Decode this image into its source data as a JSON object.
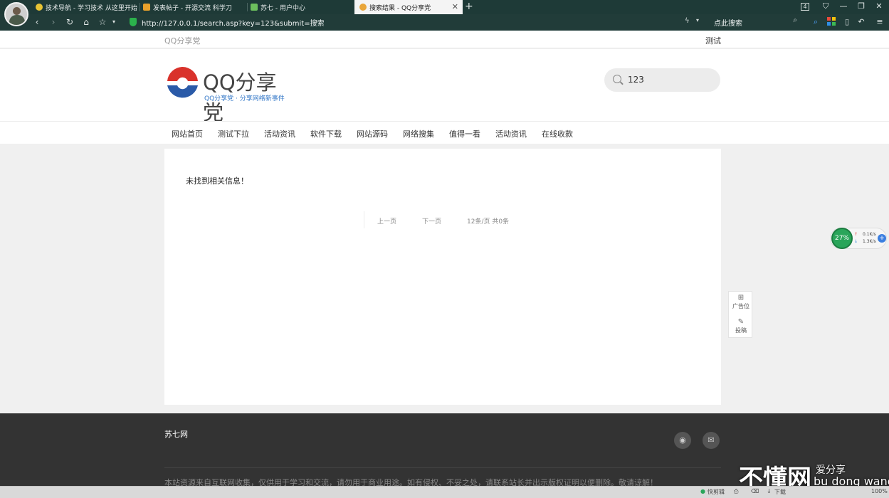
{
  "browser": {
    "tabs": [
      {
        "title": "技术导航 - 学习技术 从这里开始",
        "icon_color": "#e8c435",
        "active": false
      },
      {
        "title": "发表帖子 - 开源交流 科学刀",
        "icon_color": "#e8a12b",
        "active": false
      },
      {
        "title": "苏七 - 用户中心",
        "icon_color": "#6cbf5d",
        "active": false
      },
      {
        "title": "搜索结果 - QQ分享党",
        "icon_color": "#e9a63a",
        "active": true
      }
    ],
    "tab_count": "4",
    "url": "http://127.0.0.1/search.asp?key=123&submit=搜索",
    "search_placeholder": "点此搜索"
  },
  "site": {
    "name": "QQ分享党",
    "topbar_right": "测试",
    "logo_text": "QQ分享党",
    "logo_subtitle": "QQ分享党 · 分享网络新事件",
    "search_value": "123",
    "nav": [
      "网站首页",
      "测试下拉",
      "活动资讯",
      "软件下载",
      "网站源码",
      "网络搜集",
      "值得一看",
      "活动资讯",
      "在线收款"
    ]
  },
  "results": {
    "message": "未找到相关信息！",
    "pager": {
      "prev": "上一页",
      "next": "下一页",
      "summary": "12条/页 共0条"
    }
  },
  "footer": {
    "brand": "苏七网",
    "notice": "本站资源来自互联网收集，仅供用于学习和交流，请勿用于商业用途。如有侵权、不妥之处，请联系站长并出示版权证明以便删除。敬请谅解！"
  },
  "floating": {
    "ad_label": "广告位",
    "submit_label": "投稿",
    "net_percent": "27%",
    "net_up": "0.1K/s",
    "net_down": "1.3K/s"
  },
  "watermark": {
    "big": "不懂网",
    "small": "爱分享",
    "pinyin": "bu dong wang"
  },
  "statusbar": {
    "fast_label": "快剪辑",
    "download_label": "下载",
    "zoom": "100%"
  },
  "colors": {
    "tabbar": "#1e3a37",
    "accent_blue": "#3478c8",
    "logo_red": "#d9322b",
    "footer_bg": "#333333"
  }
}
